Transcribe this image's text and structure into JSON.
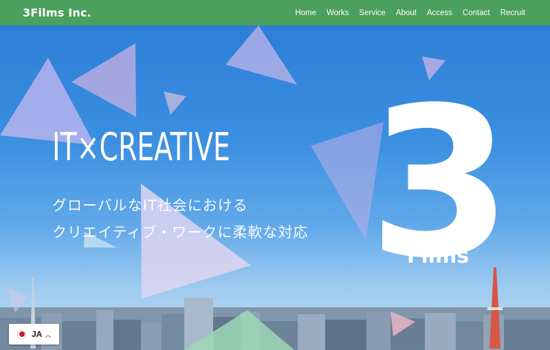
{
  "header": {
    "logo": "3Films Inc.",
    "nav": [
      "Home",
      "Works",
      "Service",
      "About",
      "Access",
      "Contact",
      "Recruit"
    ]
  },
  "hero": {
    "headline": "IT×CREATIVE",
    "subline1": "グローバルなIT社会における",
    "subline2": "クリエイティブ・ワークに柔軟な対応",
    "brand_number": "3",
    "brand_word": "Films"
  },
  "language": {
    "code": "JA",
    "flag_icon": "japan-flag-icon",
    "caret_icon": "chevron-up-icon"
  },
  "colors": {
    "header_bg": "#4aa05c",
    "sky_top": "#2d7fd7",
    "flag_red": "#cc1f2e"
  }
}
